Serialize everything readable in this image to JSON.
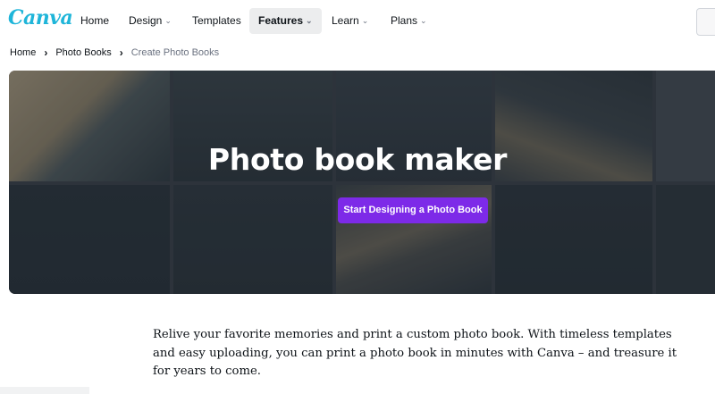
{
  "brand": {
    "logo_text": "Canva",
    "logo_color": "#1fb5d9"
  },
  "nav": {
    "items": [
      {
        "label": "Home",
        "has_dropdown": false,
        "active": false
      },
      {
        "label": "Design",
        "has_dropdown": true,
        "active": false
      },
      {
        "label": "Templates",
        "has_dropdown": false,
        "active": false
      },
      {
        "label": "Features",
        "has_dropdown": true,
        "active": true
      },
      {
        "label": "Learn",
        "has_dropdown": true,
        "active": false
      },
      {
        "label": "Plans",
        "has_dropdown": true,
        "active": false
      }
    ]
  },
  "breadcrumb": {
    "items": [
      "Home",
      "Photo Books",
      "Create Photo Books"
    ]
  },
  "hero": {
    "title": "Photo book maker",
    "cta_label": "Start Designing a Photo Book",
    "cta_color": "#7d2ae8"
  },
  "main": {
    "description": "Relive your favorite memories and print a custom photo book. With timeless templates and easy uploading, you can print a photo book in minutes with Canva – and treasure it for years to come."
  }
}
